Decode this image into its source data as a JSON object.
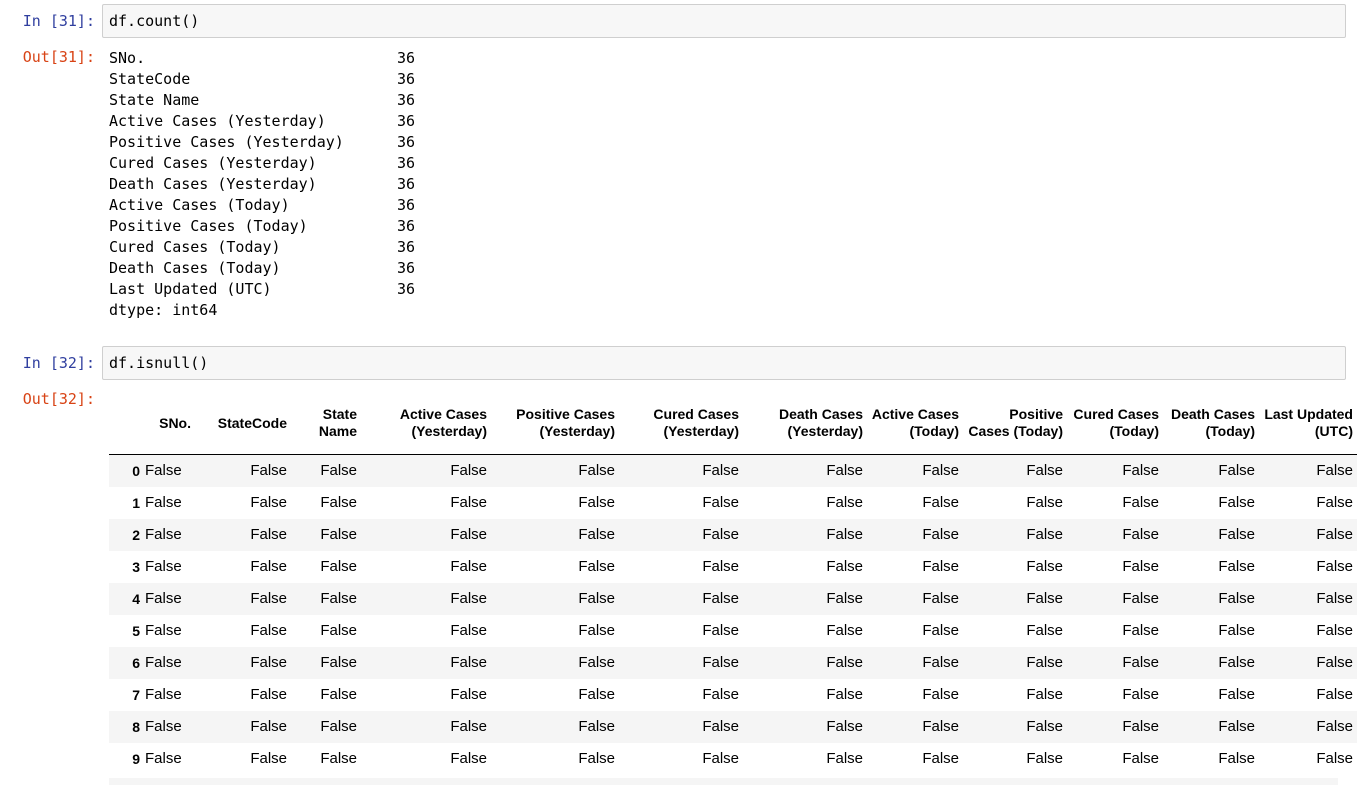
{
  "cells": [
    {
      "in_prompt": "In [31]:",
      "code": "df.count()",
      "out_prompt": "Out[31]:",
      "output": {
        "rows": [
          {
            "label": "SNo.",
            "value": "36"
          },
          {
            "label": "StateCode",
            "value": "36"
          },
          {
            "label": "State Name",
            "value": "36"
          },
          {
            "label": "Active Cases (Yesterday)",
            "value": "36"
          },
          {
            "label": "Positive Cases (Yesterday)",
            "value": "36"
          },
          {
            "label": "Cured Cases (Yesterday)",
            "value": "36"
          },
          {
            "label": "Death Cases (Yesterday)",
            "value": "36"
          },
          {
            "label": "Active Cases (Today)",
            "value": "36"
          },
          {
            "label": "Positive Cases (Today)",
            "value": "36"
          },
          {
            "label": "Cured Cases (Today)",
            "value": "36"
          },
          {
            "label": "Death Cases (Today)",
            "value": "36"
          },
          {
            "label": "Last Updated (UTC)",
            "value": "36"
          }
        ],
        "dtype": "dtype: int64"
      }
    },
    {
      "in_prompt": "In [32]:",
      "code": "df.isnull()",
      "out_prompt": "Out[32]:",
      "table": {
        "columns": [
          "SNo.",
          "StateCode",
          "State Name",
          "Active Cases (Yesterday)",
          "Positive Cases (Yesterday)",
          "Cured Cases (Yesterday)",
          "Death Cases (Yesterday)",
          "Active Cases (Today)",
          "Positive Cases (Today)",
          "Cured Cases (Today)",
          "Death Cases (Today)",
          "Last Updated (UTC)"
        ],
        "index": [
          "0",
          "1",
          "2",
          "3",
          "4",
          "5",
          "6",
          "7",
          "8",
          "9"
        ],
        "rows": [
          [
            "False",
            "False",
            "False",
            "False",
            "False",
            "False",
            "False",
            "False",
            "False",
            "False",
            "False",
            "False"
          ],
          [
            "False",
            "False",
            "False",
            "False",
            "False",
            "False",
            "False",
            "False",
            "False",
            "False",
            "False",
            "False"
          ],
          [
            "False",
            "False",
            "False",
            "False",
            "False",
            "False",
            "False",
            "False",
            "False",
            "False",
            "False",
            "False"
          ],
          [
            "False",
            "False",
            "False",
            "False",
            "False",
            "False",
            "False",
            "False",
            "False",
            "False",
            "False",
            "False"
          ],
          [
            "False",
            "False",
            "False",
            "False",
            "False",
            "False",
            "False",
            "False",
            "False",
            "False",
            "False",
            "False"
          ],
          [
            "False",
            "False",
            "False",
            "False",
            "False",
            "False",
            "False",
            "False",
            "False",
            "False",
            "False",
            "False"
          ],
          [
            "False",
            "False",
            "False",
            "False",
            "False",
            "False",
            "False",
            "False",
            "False",
            "False",
            "False",
            "False"
          ],
          [
            "False",
            "False",
            "False",
            "False",
            "False",
            "False",
            "False",
            "False",
            "False",
            "False",
            "False",
            "False"
          ],
          [
            "False",
            "False",
            "False",
            "False",
            "False",
            "False",
            "False",
            "False",
            "False",
            "False",
            "False",
            "False"
          ],
          [
            "False",
            "False",
            "False",
            "False",
            "False",
            "False",
            "False",
            "False",
            "False",
            "False",
            "False",
            "False"
          ]
        ]
      }
    }
  ]
}
